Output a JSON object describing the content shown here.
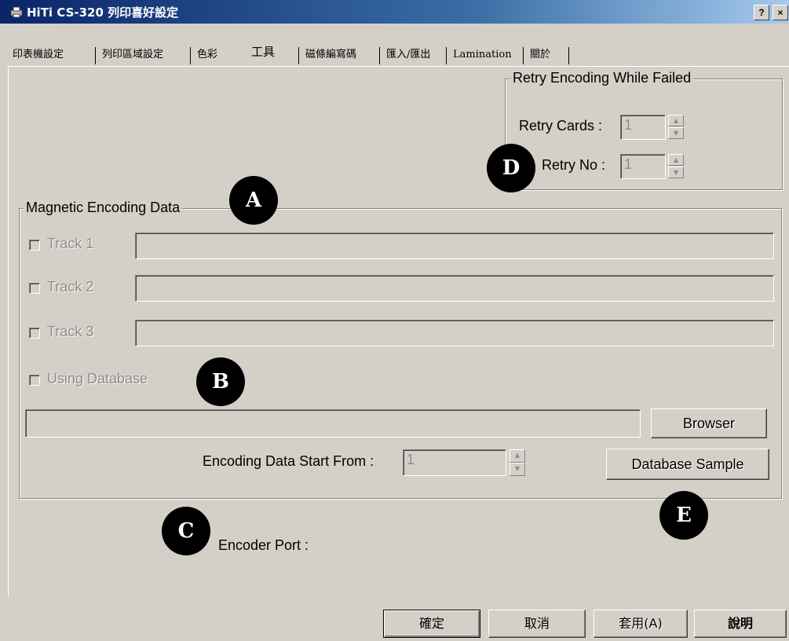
{
  "window": {
    "title": "HiTi CS-320 列印喜好設定",
    "help_button": "?",
    "close_button": "×"
  },
  "tabs": [
    {
      "label": "印表機設定"
    },
    {
      "label": "列印區域設定"
    },
    {
      "label": "色彩"
    },
    {
      "label": "工具"
    },
    {
      "label": "磁條編寫碼"
    },
    {
      "label": "匯入/匯出"
    },
    {
      "label": "Lamination"
    },
    {
      "label": "關於"
    }
  ],
  "retry_group": {
    "legend": "Retry Encoding While Failed",
    "retry_cards_label": "Retry Cards :",
    "retry_cards_value": "1",
    "retry_no_label": "Retry No :",
    "retry_no_value": "1"
  },
  "magnetic_group": {
    "legend": "Magnetic Encoding Data",
    "track1_label": "Track 1",
    "track2_label": "Track 2",
    "track3_label": "Track 3",
    "using_database_label": "Using Database",
    "database_path_value": "",
    "browser_button": "Browser",
    "start_from_label": "Encoding Data Start From :",
    "start_from_value": "1",
    "database_sample_button": "Database Sample"
  },
  "encoder_port_label": "Encoder Port :",
  "callouts": {
    "a": "A",
    "b": "B",
    "c": "C",
    "d": "D",
    "e": "E"
  },
  "buttons": {
    "ok": "確定",
    "cancel": "取消",
    "apply": "套用(A)",
    "help": "說明"
  }
}
